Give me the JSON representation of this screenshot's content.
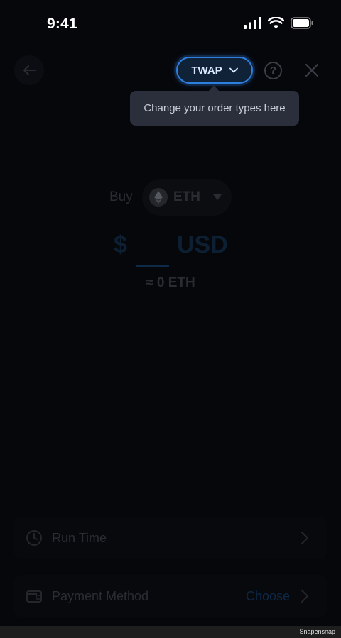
{
  "status_bar": {
    "time": "9:41"
  },
  "nav": {
    "order_type_label": "TWAP",
    "help_label": "?"
  },
  "tooltip": {
    "text": "Change your order types here"
  },
  "buy": {
    "label": "Buy",
    "asset": "ETH"
  },
  "amount": {
    "currency_symbol": "$",
    "value": "",
    "unit": "USD",
    "converted": "≈ 0 ETH"
  },
  "options": {
    "run_time": {
      "label": "Run Time"
    },
    "payment_method": {
      "label": "Payment Method",
      "value": "Choose"
    }
  },
  "watermark": "Snapensnap",
  "colors": {
    "accent": "#2f7fe0",
    "background": "#06070b",
    "tooltip": "#2a2f3b"
  }
}
